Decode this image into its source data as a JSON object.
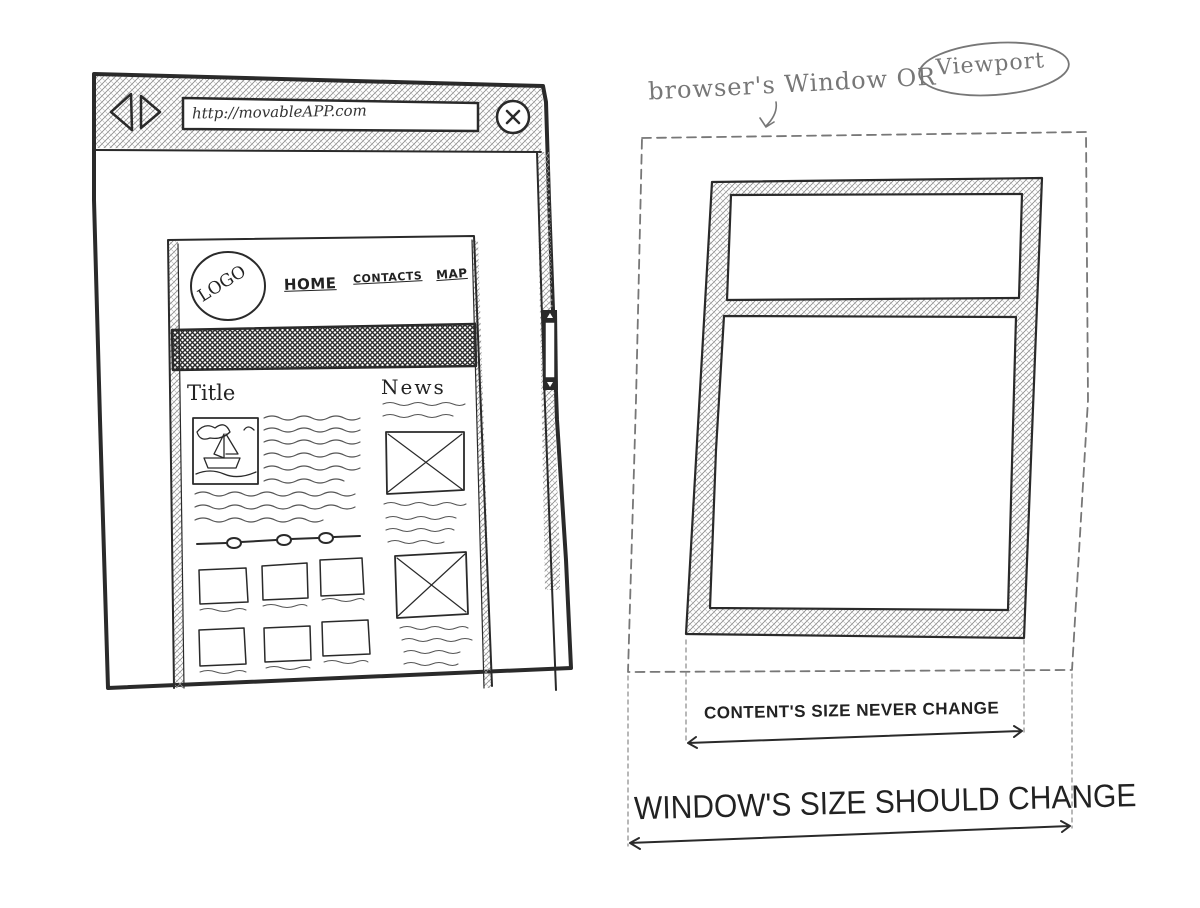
{
  "browser_sketch": {
    "address_bar_text": "http://movableAPP.com",
    "logo_text": "LOGO",
    "nav": {
      "home": "HOME",
      "contacts": "CONTACTS",
      "map": "MAP"
    },
    "content_title": "Title",
    "news_heading": "News"
  },
  "viewport_sketch": {
    "window_label": "browser's Window OR",
    "viewport_label": "Viewport",
    "content_size_caption": "CONTENT'S SIZE NEVER CHANGE",
    "window_size_caption": "WINDOW'S SIZE SHOULD CHANGE"
  },
  "colors": {
    "ink": "#2a2a2a",
    "pencil_gray": "#777777",
    "hatch": "#9a9a9a"
  }
}
